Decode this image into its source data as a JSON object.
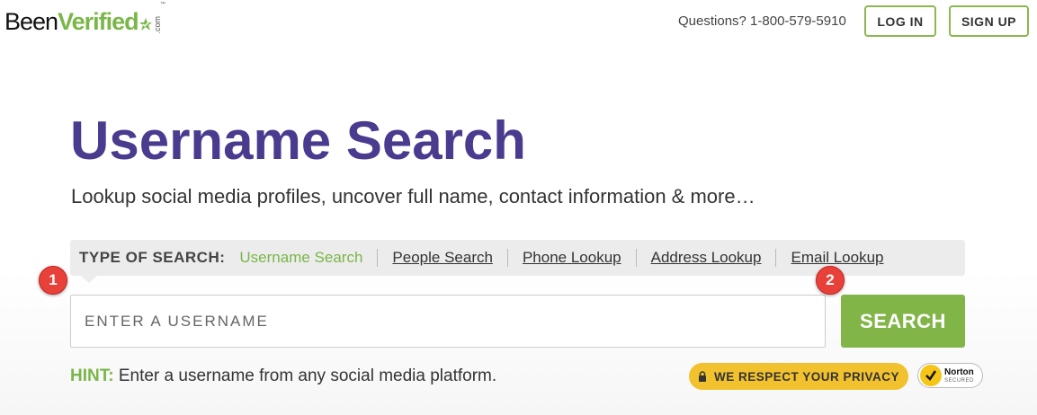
{
  "header": {
    "logo": {
      "part1": "Been",
      "part2": "Verified",
      "suffix": ".com",
      "tm": "™"
    },
    "questions": "Questions? 1-800-579-5910",
    "login_label": "LOG IN",
    "signup_label": "SIGN UP"
  },
  "hero": {
    "title": "Username Search",
    "subtitle": "Lookup social media profiles, uncover full name, contact information & more…"
  },
  "search_types": {
    "label": "TYPE OF SEARCH:",
    "active": "Username Search",
    "links": [
      "People Search",
      "Phone Lookup",
      "Address Lookup",
      "Email Lookup"
    ]
  },
  "search": {
    "placeholder": "ENTER A USERNAME",
    "button_label": "SEARCH"
  },
  "hint": {
    "label": "HINT:",
    "text": " Enter a username from any social media platform."
  },
  "badges": {
    "privacy": "WE RESPECT YOUR PRIVACY",
    "norton_name": "Norton",
    "norton_sub": "SECURED"
  },
  "markers": [
    "1",
    "2"
  ],
  "colors": {
    "brand_green": "#82b548",
    "title_purple": "#4a3b8f",
    "privacy_yellow": "#f2c12e",
    "marker_red": "#e8413a"
  }
}
